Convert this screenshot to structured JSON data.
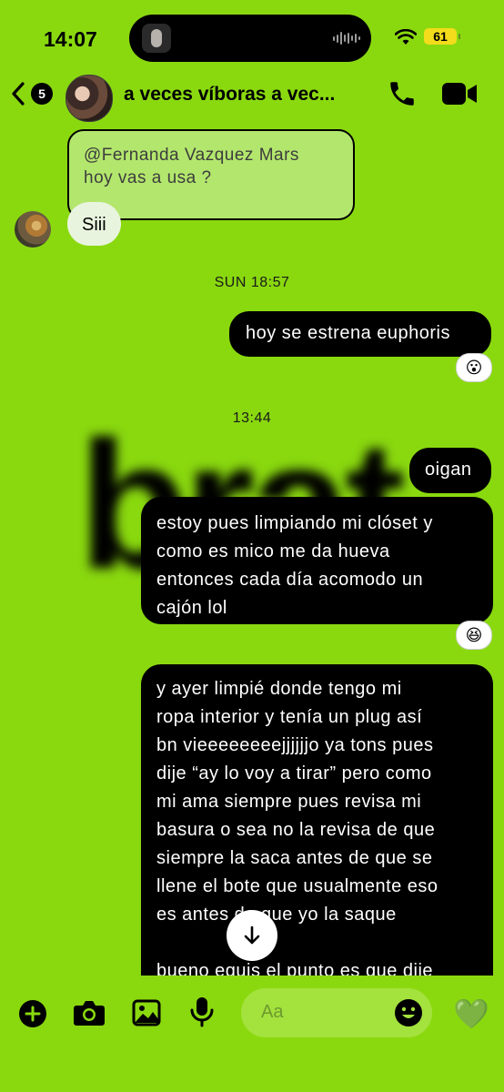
{
  "status_bar": {
    "time": "14:07",
    "battery": "61"
  },
  "header": {
    "back_count": "5",
    "title": "a veces víboras a vec..."
  },
  "messages": {
    "reply_quote_line1": "@Fernanda Vazquez Mars",
    "reply_quote_line2": "hoy vas a usa ?",
    "reply_text": "Siii",
    "timestamp1": "SUN 18:57",
    "msg1": "hoy se estrena euphoris",
    "msg1_reaction": "😮",
    "timestamp2": "13:44",
    "sticker_text": "brat",
    "msg2": "oigan",
    "msg3": [
      "estoy pues limpiando mi clóset y",
      "como es mico me da hueva",
      "entonces cada día acomodo un",
      "cajón lol"
    ],
    "msg3_reaction": "😆",
    "msg4": [
      "y ayer limpié donde tengo mi",
      "ropa interior y tenía un plug así",
      "bn vieeeeeeeejjjjjjo ya tons pues",
      "dije “ay lo voy a tirar” pero como",
      "mi ama siempre pues revisa mi",
      "basura o sea no la revisa de que",
      "siempre la saca antes de que se",
      "llene el bote que usualmente eso",
      "es antes de que yo la saque",
      "",
      "bueno equis el punto es que dije"
    ]
  },
  "composer": {
    "placeholder": "Aa",
    "like_emoji": "💚"
  },
  "icons": [
    "back-chevron-icon",
    "phone-icon",
    "video-camera-icon",
    "plus-icon",
    "camera-icon",
    "image-icon",
    "microphone-icon",
    "smiley-icon",
    "arrow-down-icon"
  ],
  "colors": {
    "background": "#8ad90f",
    "bubble_out": "#000000",
    "bubble_in": "#e9f4df",
    "battery": "#f3dc1b"
  }
}
